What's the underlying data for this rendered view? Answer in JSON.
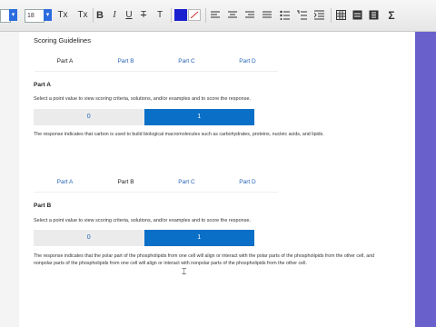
{
  "toolbar": {
    "font_size": "18",
    "superscript": "Tx",
    "subscript": "Tx",
    "bold": "B",
    "italic": "I",
    "underline": "U",
    "strikethrough": "T",
    "clear_format": "T",
    "text_color": "#1a20d0",
    "highlight_color": "#ffffff",
    "sigma": "Σ"
  },
  "page": {
    "title": "Scoring Guidelines",
    "tabs": [
      "Part A",
      "Part B",
      "Part C",
      "Part D"
    ],
    "part_a": {
      "heading": "Part A",
      "instruction": "Select a point value to view scoring criteria, solutions, and/or examples and to score the response.",
      "choices": [
        "0",
        "1"
      ],
      "response": "The response indicates that carbon is used to build biological macromolecules such as carbohydrates, proteins, nucleic acids, and lipids."
    },
    "part_b": {
      "heading": "Part B",
      "instruction": "Select a point value to view scoring criteria, solutions, and/or examples and to score the response.",
      "choices": [
        "0",
        "1"
      ],
      "response": "The response indicates that the polar part of the phospholipids from one cell will align or interact with the polar parts of the phospholipids from the other cell, and nonpolar parts of the phospholipids from one cell will align or interact with nonpolar parts of the phospholipids from the other cell."
    }
  }
}
